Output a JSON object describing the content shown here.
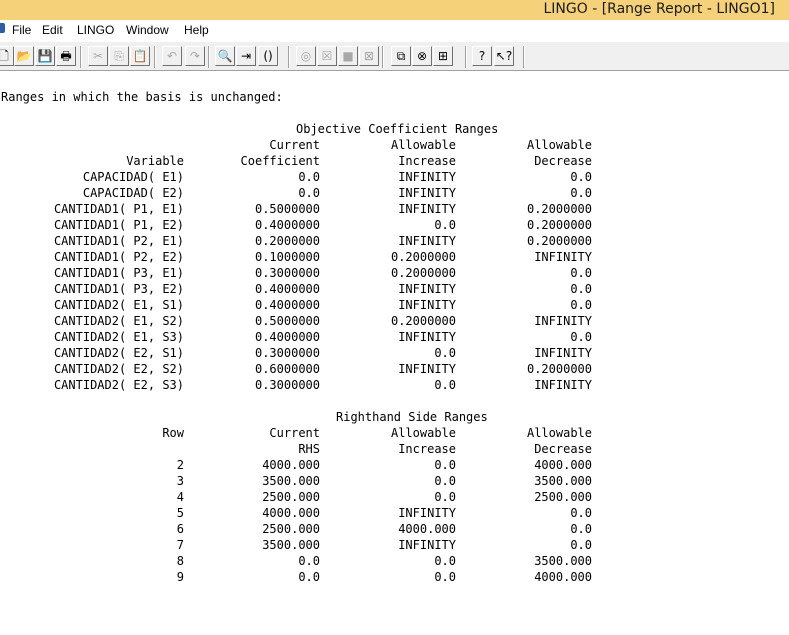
{
  "window": {
    "title": "LINGO - [Range Report - LINGO1]"
  },
  "menu": [
    "File",
    "Edit",
    "LINGO",
    "Window",
    "Help"
  ],
  "toolbar": {
    "buttons": [
      {
        "name": "new-icon",
        "glyph": "🗋"
      },
      {
        "name": "open-icon",
        "glyph": "📂"
      },
      {
        "name": "save-icon",
        "glyph": "💾"
      },
      {
        "name": "print-icon",
        "glyph": "🖶"
      },
      {
        "name": "cut-icon",
        "glyph": "✂"
      },
      {
        "name": "copy-icon",
        "glyph": "⎘"
      },
      {
        "name": "paste-icon",
        "glyph": "📋"
      },
      {
        "name": "undo-icon",
        "glyph": "↶"
      },
      {
        "name": "redo-icon",
        "glyph": "↷"
      },
      {
        "name": "find-icon",
        "glyph": "🔍"
      },
      {
        "name": "goto-line-icon",
        "glyph": "⇥"
      },
      {
        "name": "match-parenthesis-icon",
        "glyph": "()"
      },
      {
        "name": "solve-icon",
        "glyph": "◎"
      },
      {
        "name": "solution-icon",
        "glyph": "☒"
      },
      {
        "name": "stop-icon",
        "glyph": "■"
      },
      {
        "name": "close-icon",
        "glyph": "⊠"
      },
      {
        "name": "send-to-back-icon",
        "glyph": "⧉"
      },
      {
        "name": "close-all-icon",
        "glyph": "⊗"
      },
      {
        "name": "tile-icon",
        "glyph": "⊞"
      },
      {
        "name": "help-icon",
        "glyph": "?"
      },
      {
        "name": "context-help-icon",
        "glyph": "↖?"
      }
    ]
  },
  "report": {
    "intro": "Ranges in which the basis is unchanged:",
    "objective": {
      "title": "Objective Coefficient Ranges",
      "headers": {
        "col1": [
          "",
          "Variable"
        ],
        "col2": [
          "Current",
          "Coefficient"
        ],
        "col3": [
          "Allowable",
          "Increase"
        ],
        "col4": [
          "Allowable",
          "Decrease"
        ]
      },
      "rows": [
        [
          "CAPACIDAD( E1)",
          "0.0",
          "INFINITY",
          "0.0"
        ],
        [
          "CAPACIDAD( E2)",
          "0.0",
          "INFINITY",
          "0.0"
        ],
        [
          "CANTIDAD1( P1, E1)",
          "0.5000000",
          "INFINITY",
          "0.2000000"
        ],
        [
          "CANTIDAD1( P1, E2)",
          "0.4000000",
          "0.0",
          "0.2000000"
        ],
        [
          "CANTIDAD1( P2, E1)",
          "0.2000000",
          "INFINITY",
          "0.2000000"
        ],
        [
          "CANTIDAD1( P2, E2)",
          "0.1000000",
          "0.2000000",
          "INFINITY"
        ],
        [
          "CANTIDAD1( P3, E1)",
          "0.3000000",
          "0.2000000",
          "0.0"
        ],
        [
          "CANTIDAD1( P3, E2)",
          "0.4000000",
          "INFINITY",
          "0.0"
        ],
        [
          "CANTIDAD2( E1, S1)",
          "0.4000000",
          "INFINITY",
          "0.0"
        ],
        [
          "CANTIDAD2( E1, S2)",
          "0.5000000",
          "0.2000000",
          "INFINITY"
        ],
        [
          "CANTIDAD2( E1, S3)",
          "0.4000000",
          "INFINITY",
          "0.0"
        ],
        [
          "CANTIDAD2( E2, S1)",
          "0.3000000",
          "0.0",
          "INFINITY"
        ],
        [
          "CANTIDAD2( E2, S2)",
          "0.6000000",
          "INFINITY",
          "0.2000000"
        ],
        [
          "CANTIDAD2( E2, S3)",
          "0.3000000",
          "0.0",
          "INFINITY"
        ]
      ]
    },
    "rhs": {
      "title": "Righthand Side Ranges",
      "headers": {
        "col1": [
          "Row",
          ""
        ],
        "col2": [
          "Current",
          "RHS"
        ],
        "col3": [
          "Allowable",
          "Increase"
        ],
        "col4": [
          "Allowable",
          "Decrease"
        ]
      },
      "rows": [
        [
          "2",
          "4000.000",
          "0.0",
          "4000.000"
        ],
        [
          "3",
          "3500.000",
          "0.0",
          "3500.000"
        ],
        [
          "4",
          "2500.000",
          "0.0",
          "2500.000"
        ],
        [
          "5",
          "4000.000",
          "INFINITY",
          "0.0"
        ],
        [
          "6",
          "2500.000",
          "4000.000",
          "0.0"
        ],
        [
          "7",
          "3500.000",
          "INFINITY",
          "0.0"
        ],
        [
          "8",
          "0.0",
          "0.0",
          "3500.000"
        ],
        [
          "9",
          "0.0",
          "0.0",
          "4000.000"
        ]
      ]
    }
  }
}
